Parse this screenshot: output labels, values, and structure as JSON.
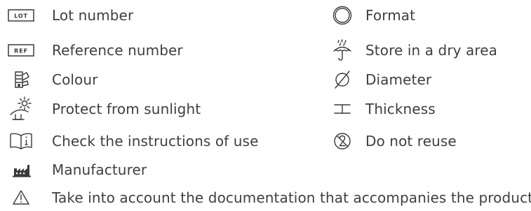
{
  "legend": {
    "items": [
      {
        "icon": "lot-icon",
        "label": "Lot number",
        "icon_text": "LOT"
      },
      {
        "icon": "ref-icon",
        "label": "Reference number",
        "icon_text": "REF"
      },
      {
        "icon": "colour-swatch-icon",
        "label": "Colour"
      },
      {
        "icon": "sunlight-protection-icon",
        "label": "Protect from sunlight"
      },
      {
        "icon": "instructions-book-icon",
        "label": "Check the instructions of use"
      },
      {
        "icon": "manufacturer-factory-icon",
        "label": "Manufacturer"
      },
      {
        "icon": "warning-triangle-icon",
        "label": "Take into account the documentation that accompanies the product"
      },
      {
        "icon": "format-circle-icon",
        "label": "Format"
      },
      {
        "icon": "umbrella-rain-icon",
        "label": "Store in a dry area"
      },
      {
        "icon": "diameter-icon",
        "label": "Diameter"
      },
      {
        "icon": "thickness-icon",
        "label": "Thickness"
      },
      {
        "icon": "do-not-reuse-icon",
        "label": "Do not reuse"
      }
    ]
  },
  "colors": {
    "text": "#3f3f3f",
    "icon": "#3a3a3a"
  }
}
